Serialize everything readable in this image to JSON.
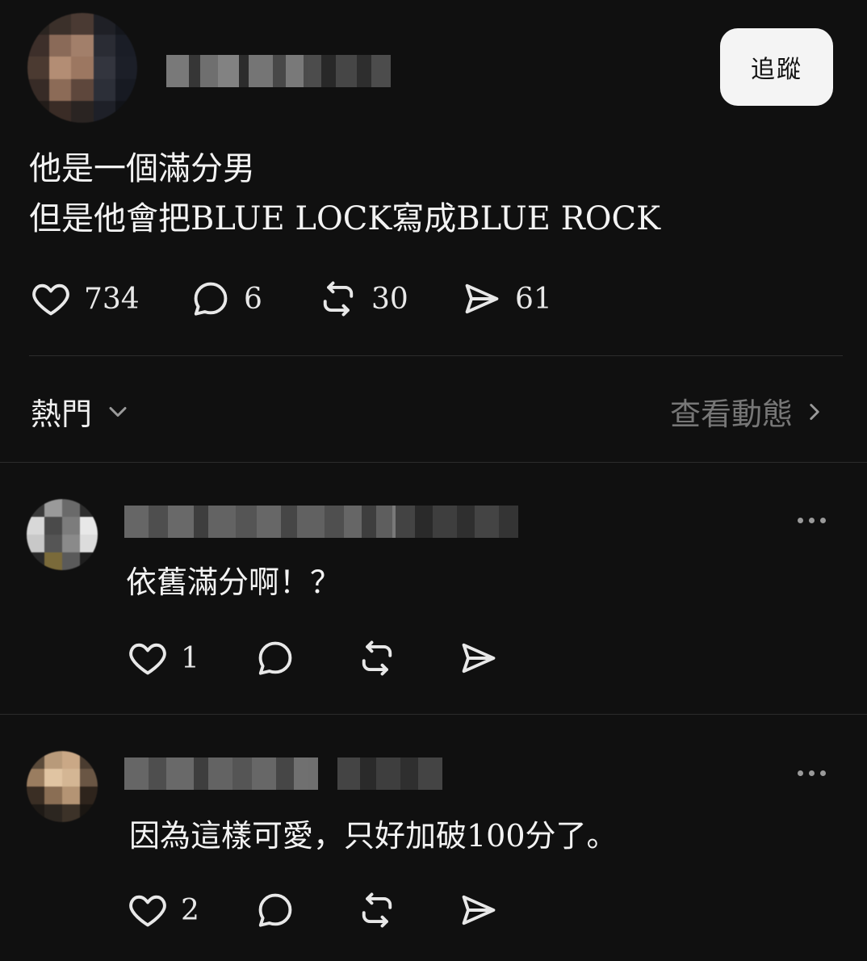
{
  "post": {
    "follow_label": "追蹤",
    "text_line1": "他是一個滿分男",
    "text_line2": "但是他會把BLUE LOCK寫成BLUE ROCK",
    "likes": "734",
    "replies": "6",
    "reposts": "30",
    "shares": "61"
  },
  "sort": {
    "label": "熱門",
    "activity_label": "查看動態"
  },
  "comments": [
    {
      "text": "依舊滿分啊！？",
      "likes": "1"
    },
    {
      "text": "因為這樣可愛，只好加破100分了。",
      "likes": "2"
    }
  ],
  "colors": {
    "background": "#101010",
    "text": "#f3f3f3",
    "muted": "#777777",
    "button_bg": "#f4f4f4"
  },
  "icons": [
    "heart-icon",
    "comment-icon",
    "repost-icon",
    "share-icon",
    "chevron-down-icon",
    "chevron-right-icon",
    "more-icon"
  ]
}
